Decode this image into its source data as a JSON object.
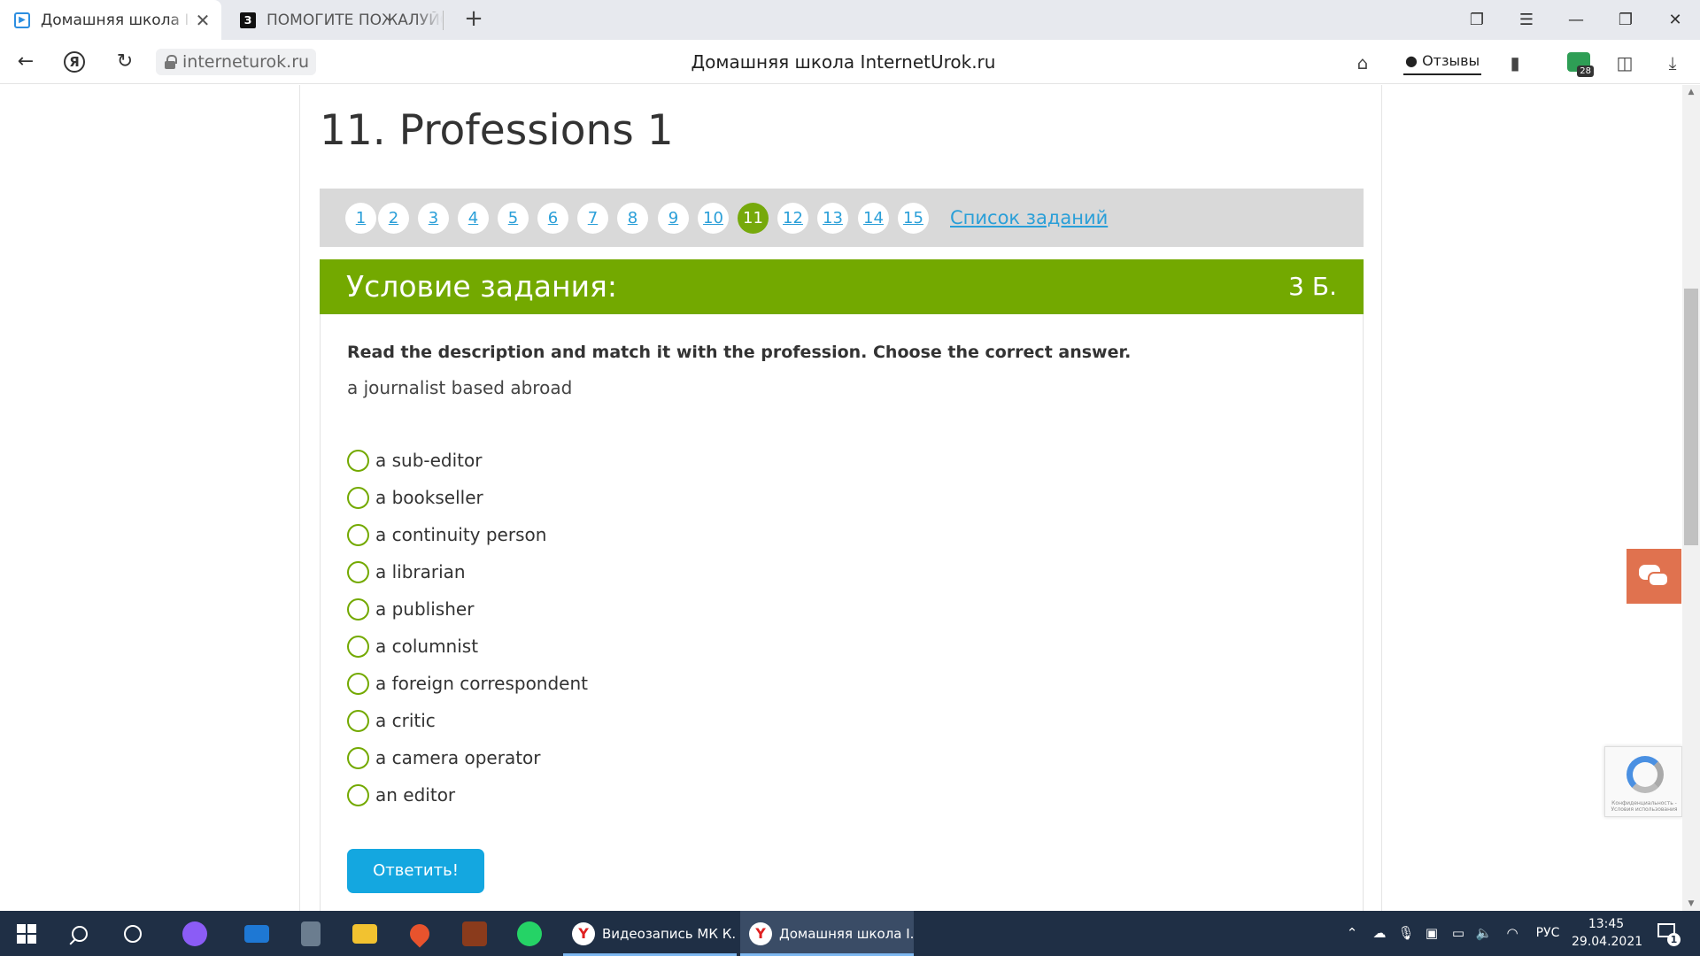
{
  "browser": {
    "tabs": [
      {
        "title": "Домашняя школа InternetUrok.ru",
        "active": true
      },
      {
        "title": "ПОМОГИТЕ ПОЖАЛУЙСТА",
        "favicon": "З"
      }
    ],
    "new_tab": "+",
    "url": "interneturok.ru",
    "page_title": "Домашняя школа InternetUrok.ru",
    "reviews_label": "Отзывы",
    "extension_badge": "28",
    "yandex_button": "Я"
  },
  "lesson": {
    "title": "11. Professions 1",
    "pages": [
      "1",
      "2",
      "3",
      "4",
      "5",
      "6",
      "7",
      "8",
      "9",
      "10",
      "11",
      "12",
      "13",
      "14",
      "15"
    ],
    "current_page": "11",
    "task_list_link": "Список заданий"
  },
  "task": {
    "header": "Условие задания:",
    "points": "3 Б.",
    "instruction": "Read the description and match it with the profession. Choose the correct answer.",
    "question": "a journalist based abroad",
    "options": [
      "a sub-editor",
      "a bookseller",
      "a continuity person",
      "a librarian",
      "a publisher",
      "a columnist",
      "a foreign correspondent",
      "a critic",
      "a camera operator",
      "an editor"
    ],
    "submit_label": "Ответить!"
  },
  "recaptcha": {
    "text": "Конфиденциальность - Условия использования"
  },
  "taskbar": {
    "tasks": [
      {
        "label": "Видеозапись МК К...",
        "active": false
      },
      {
        "label": "Домашняя школа I...",
        "active": true
      }
    ],
    "language": "РУС",
    "time": "13:45",
    "date": "29.04.2021",
    "notification_count": "1"
  },
  "colors": {
    "accent_green": "#73a900",
    "link_blue": "#2a9fd8",
    "button_blue": "#14a7e0",
    "chat_orange": "#e0724f",
    "taskbar": "#1f2f45"
  }
}
